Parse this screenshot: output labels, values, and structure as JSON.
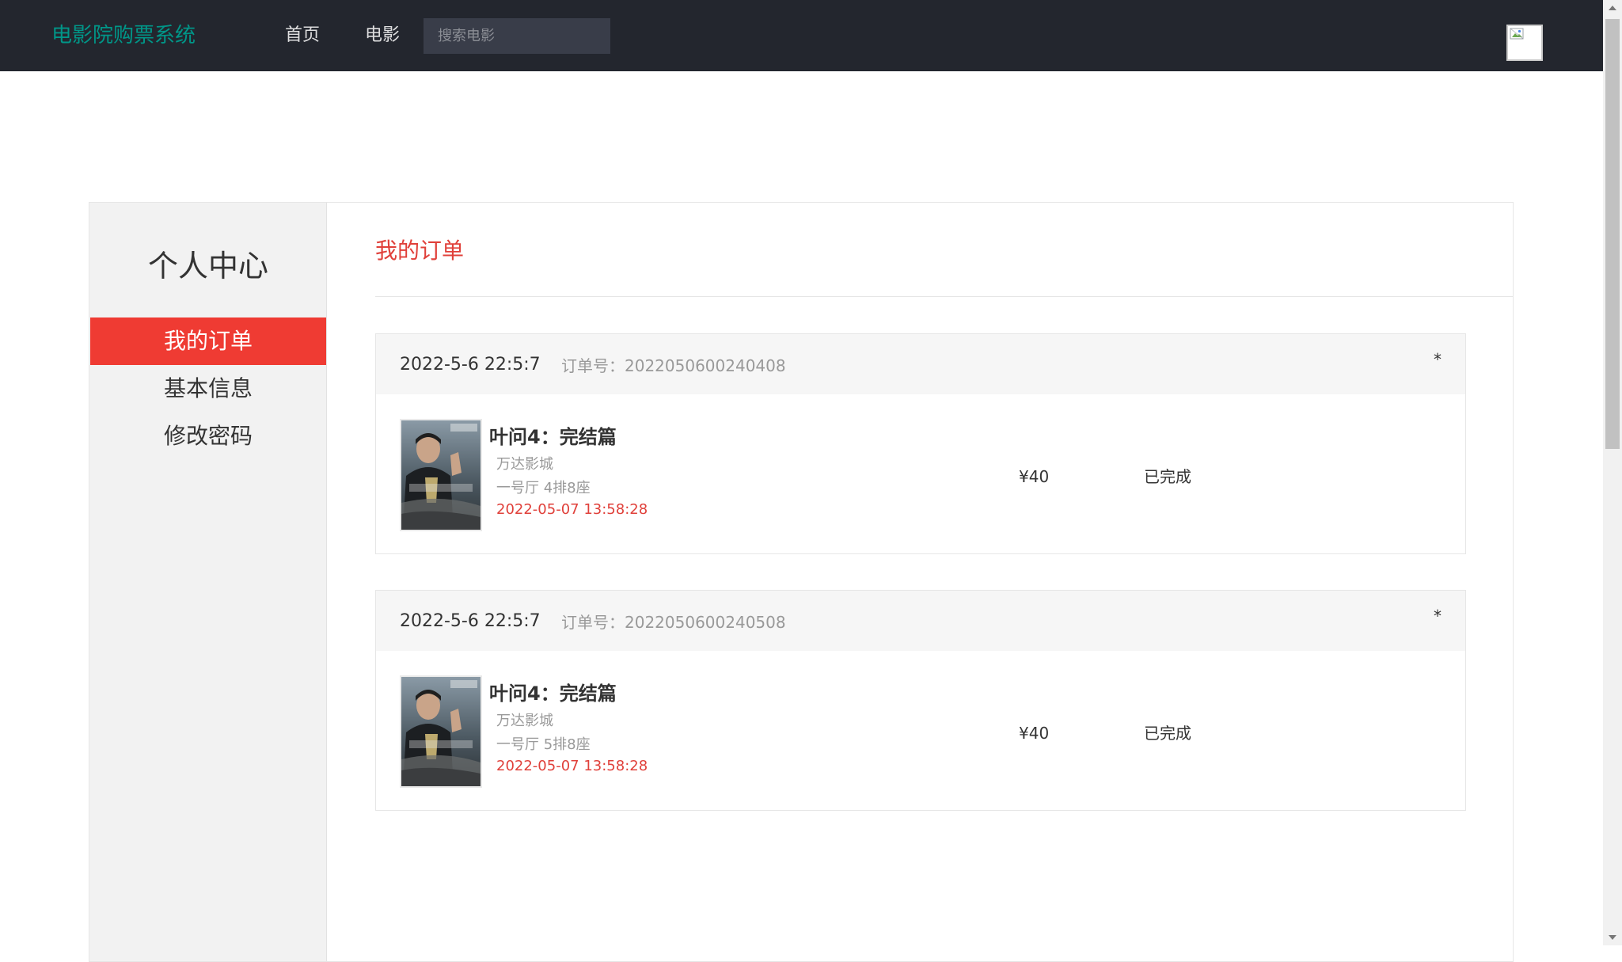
{
  "header": {
    "brand": "电影院购票系统",
    "nav": [
      {
        "label": "首页"
      },
      {
        "label": "电影"
      }
    ],
    "search_placeholder": "搜索电影"
  },
  "sidebar": {
    "title": "个人中心",
    "items": [
      {
        "label": "我的订单",
        "active": true
      },
      {
        "label": "基本信息",
        "active": false
      },
      {
        "label": "修改密码",
        "active": false
      }
    ]
  },
  "main": {
    "title": "我的订单",
    "orders": [
      {
        "date": "2022-5-6 22:5:7",
        "order_no": "订单号：2022050600240408",
        "star": "*",
        "movie_title": "叶问4：完结篇",
        "cinema": "万达影城",
        "seat": "一号厅 4排8座",
        "showtime": "2022-05-07 13:58:28",
        "price": "¥40",
        "status": "已完成"
      },
      {
        "date": "2022-5-6 22:5:7",
        "order_no": "订单号：2022050600240508",
        "star": "*",
        "movie_title": "叶问4：完结篇",
        "cinema": "万达影城",
        "seat": "一号厅 5排8座",
        "showtime": "2022-05-07 13:58:28",
        "price": "¥40",
        "status": "已完成"
      }
    ]
  },
  "colors": {
    "topbar_bg": "#23262e",
    "brand": "#009688",
    "accent_red": "#ef3b33",
    "sidebar_bg": "#f2f2f2"
  },
  "icons": {
    "avatar": "broken-image-icon",
    "poster": "movie-poster"
  }
}
